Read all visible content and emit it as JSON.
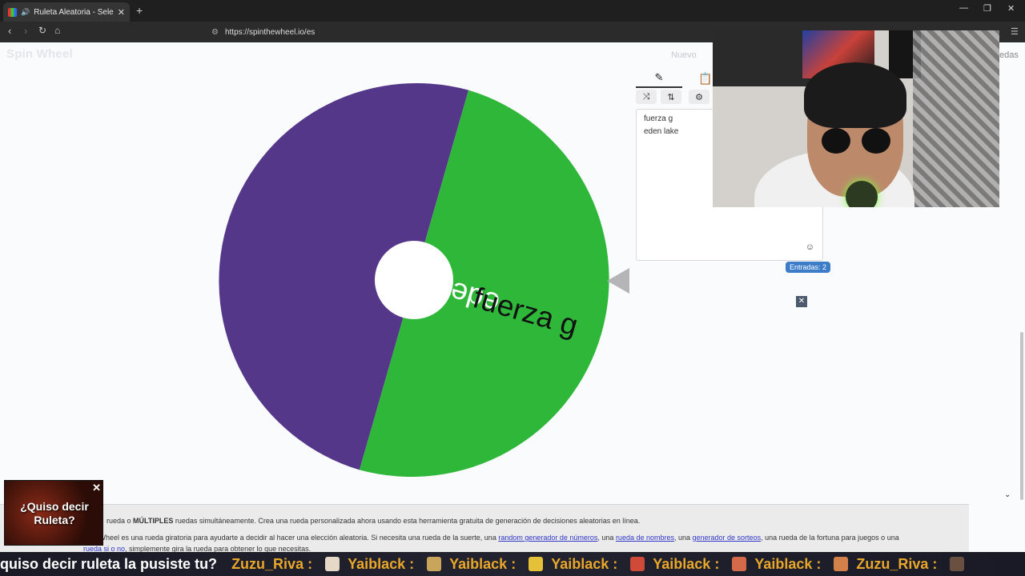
{
  "browser": {
    "tab_title": "Ruleta Aleatoria - Selector Pe",
    "url": "https://spinthewheel.io/es"
  },
  "site": {
    "logo": "Spin Wheel",
    "nav_new": "Nuevo",
    "nav_right_partial": "edas"
  },
  "wheel": {
    "segments": [
      {
        "label": "eden lake",
        "color": "#55378a"
      },
      {
        "label": "fuerza g",
        "color": "#2fb73a"
      }
    ]
  },
  "editor": {
    "entries": [
      "fuerza g",
      "eden lake"
    ],
    "entries_badge": "Entradas: 2"
  },
  "popup": {
    "text_line1": "¿Quiso decir",
    "text_line2": "Ruleta?"
  },
  "content": {
    "line1_a": "rueda o ",
    "line1_bold": "MÚLTIPLES",
    "line1_b": " ruedas simultáneamente. Crea una rueda personalizada ahora usando esta herramienta gratuita de generación de decisiones aleatorias en línea.",
    "line2_a": "e Wheel es una rueda giratoria para ayudarte a decidir al hacer una elección aleatoria. Si necesita una rueda de la suerte, una ",
    "link1": "random generador de números",
    "line2_b": ", una ",
    "link2": "rueda de nombres",
    "line2_c": ", una ",
    "link3": "generador de sorteos",
    "line2_d": ", una rueda de la fortuna para juegos o una",
    "line3_link": "rueda si o no",
    "line3_rest": ", simplemente gira la rueda para obtener lo que necesitas."
  },
  "chat": [
    {
      "user": "",
      "message": "quiso decir ruleta la pusiste tu?"
    },
    {
      "user": "Zuzu_Riva :",
      "message": ""
    },
    {
      "user": "Yaiblack :",
      "message": ""
    },
    {
      "user": "Yaiblack :",
      "message": ""
    },
    {
      "user": "Yaiblack :",
      "message": ""
    },
    {
      "user": "Yaiblack :",
      "message": ""
    },
    {
      "user": "Yaiblack :",
      "message": ""
    },
    {
      "user": "Zuzu_Riva :",
      "message": ""
    }
  ]
}
